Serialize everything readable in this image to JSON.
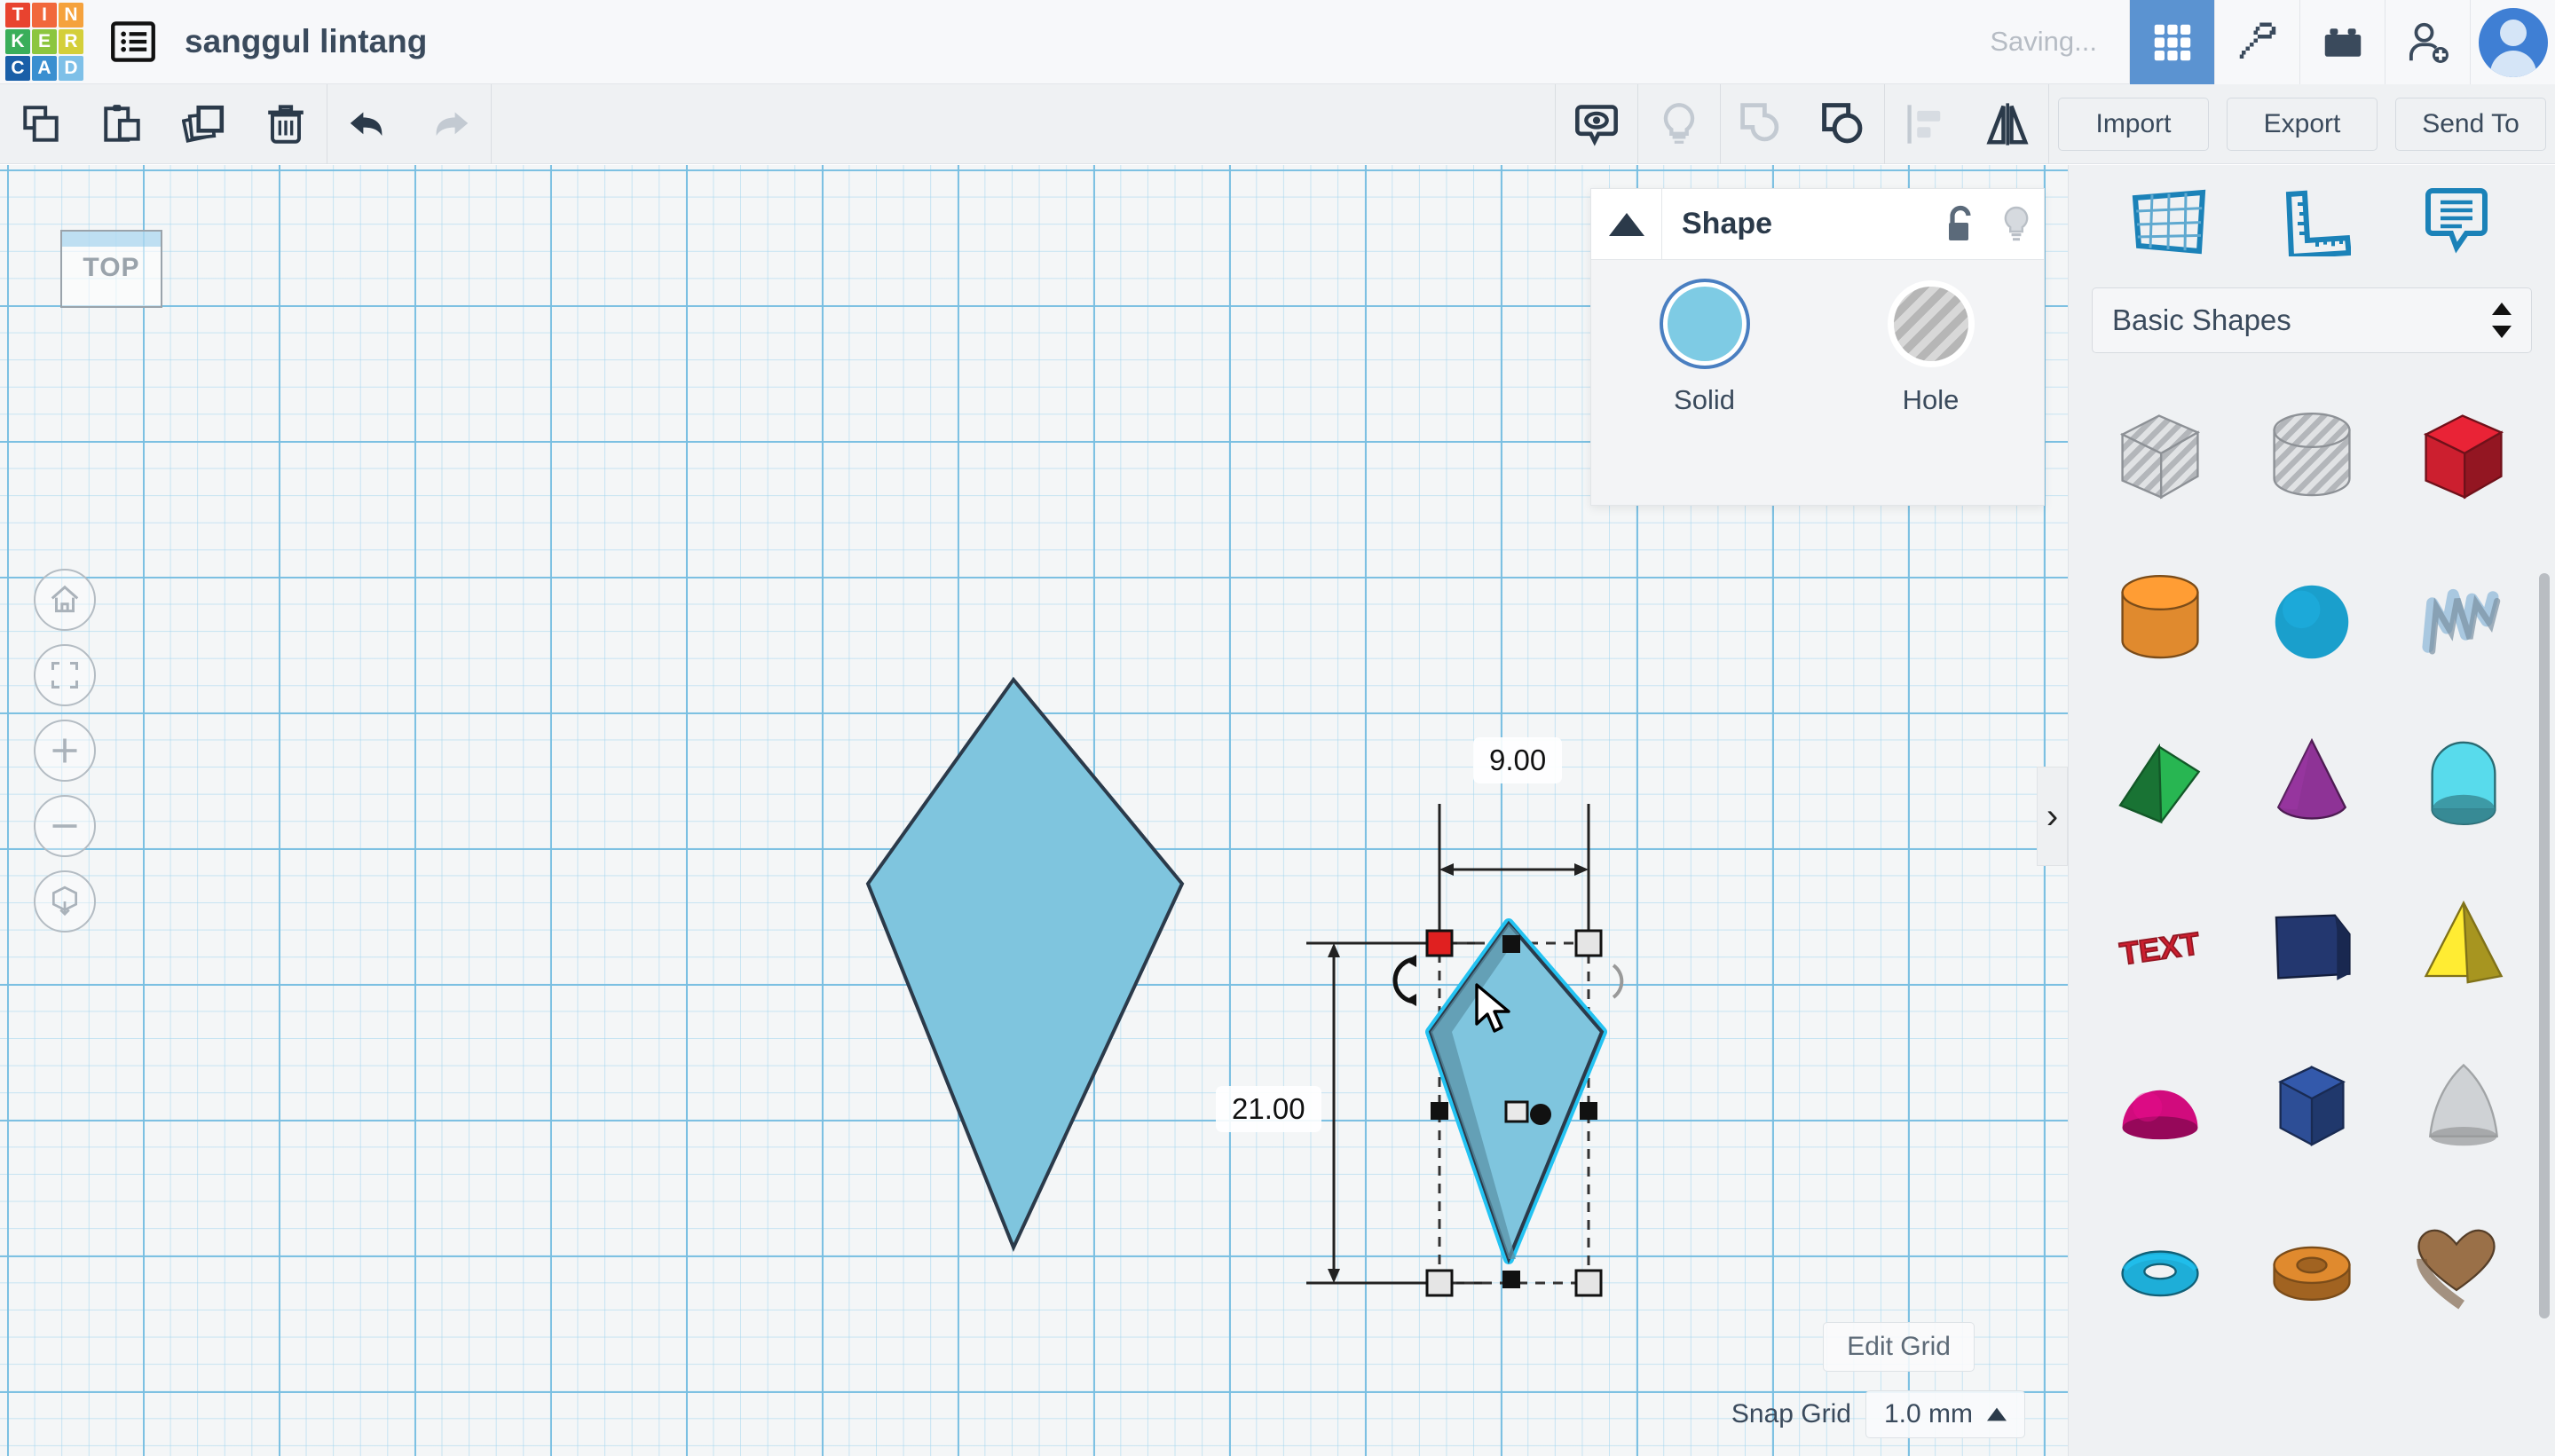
{
  "header": {
    "logo_letters": [
      "T",
      "I",
      "N",
      "K",
      "E",
      "R",
      "C",
      "A",
      "D"
    ],
    "logo_colors": [
      "#e8432f",
      "#f1683c",
      "#f5a23d",
      "#3aae5a",
      "#8cc63f",
      "#d4cf3a",
      "#1a5fa8",
      "#3a8fd0",
      "#7ec0e8"
    ],
    "design_list_icon": "list-icon",
    "title": "sanggul lintang",
    "status": "Saving...",
    "icons": [
      {
        "name": "gallery-grid-icon",
        "active": true
      },
      {
        "name": "minecraft-pickaxe-icon",
        "active": false
      },
      {
        "name": "lego-brick-icon",
        "active": false
      },
      {
        "name": "invite-person-icon",
        "active": false
      }
    ],
    "avatar": "user-avatar"
  },
  "toolbar": {
    "left_icons": [
      {
        "name": "copy-icon",
        "enabled": true
      },
      {
        "name": "paste-icon",
        "enabled": true
      },
      {
        "name": "duplicate-icon",
        "enabled": true
      },
      {
        "name": "delete-trash-icon",
        "enabled": true
      },
      {
        "name": "undo-icon",
        "enabled": true
      },
      {
        "name": "redo-icon",
        "enabled": false
      }
    ],
    "center_icons": [
      {
        "name": "show-hide-eye-icon",
        "enabled": true
      },
      {
        "name": "lightbulb-icon",
        "enabled": false
      },
      {
        "name": "ungroup-icon",
        "enabled": false
      },
      {
        "name": "group-icon",
        "enabled": true
      },
      {
        "name": "align-icon",
        "enabled": false
      },
      {
        "name": "mirror-flip-icon",
        "enabled": true
      }
    ],
    "import_label": "Import",
    "export_label": "Export",
    "sendto_label": "Send To"
  },
  "canvas": {
    "view_cube_label": "TOP",
    "nav_buttons": [
      {
        "name": "home-view-icon"
      },
      {
        "name": "fit-to-view-icon"
      },
      {
        "name": "zoom-in-icon"
      },
      {
        "name": "zoom-out-icon"
      },
      {
        "name": "perspective-toggle-icon"
      }
    ],
    "dimension_width": "9.00",
    "dimension_height": "21.00",
    "edit_grid_label": "Edit Grid",
    "snap_grid_label": "Snap Grid",
    "snap_grid_value": "1.0 mm",
    "shape_fill_color": "#7fc5de",
    "shape_outline_color": "#2b3a4a",
    "selection_highlight_color": "#24c3f2",
    "objects": [
      {
        "name": "kite-shape-large",
        "selected": false
      },
      {
        "name": "kite-shape-small",
        "selected": true
      }
    ]
  },
  "shape_panel": {
    "collapse_icon": "triangle-up-icon",
    "title": "Shape",
    "lock_icon": "unlock-icon",
    "light_icon": "lightbulb-icon",
    "options": [
      {
        "label": "Solid",
        "selected": true
      },
      {
        "label": "Hole",
        "selected": false
      }
    ]
  },
  "sidebar": {
    "top_icons": [
      {
        "name": "workplane-icon"
      },
      {
        "name": "ruler-icon"
      },
      {
        "name": "notes-icon"
      }
    ],
    "category_label": "Basic Shapes",
    "category_caret": "stepper-updown-icon",
    "shapes": [
      {
        "name": "box-hole",
        "color": "#c9cccf",
        "kind": "box",
        "hole": true
      },
      {
        "name": "cylinder-hole",
        "color": "#c9cccf",
        "kind": "cylinder",
        "hole": true
      },
      {
        "name": "box-red",
        "color": "#cc1f2f",
        "kind": "box",
        "hole": false
      },
      {
        "name": "cylinder-orange",
        "color": "#e08a2e",
        "kind": "cylinder",
        "hole": false
      },
      {
        "name": "sphere-blue",
        "color": "#1a9fcc",
        "kind": "sphere",
        "hole": false
      },
      {
        "name": "scribble-lightblue",
        "color": "#a9c8e0",
        "kind": "scribble",
        "hole": false
      },
      {
        "name": "wedge-green",
        "color": "#23a048",
        "kind": "wedge",
        "hole": false
      },
      {
        "name": "cone-purple",
        "color": "#8e3396",
        "kind": "cone",
        "hole": false
      },
      {
        "name": "roof-teal",
        "color": "#4dc0cf",
        "kind": "roof",
        "hole": false
      },
      {
        "name": "text-red",
        "color": "#cc1f2f",
        "kind": "text",
        "hole": false
      },
      {
        "name": "polygon-navy",
        "color": "#23376f",
        "kind": "polyblock",
        "hole": false
      },
      {
        "name": "pyramid-yellow",
        "color": "#e8cf2d",
        "kind": "pyramid",
        "hole": false
      },
      {
        "name": "halfsphere-pink",
        "color": "#d10b7d",
        "kind": "halfsphere",
        "hole": false
      },
      {
        "name": "hexprism-blue",
        "color": "#2d4e96",
        "kind": "hexprism",
        "hole": false
      },
      {
        "name": "paraboloid-gray",
        "color": "#cfd2d5",
        "kind": "paraboloid",
        "hole": false
      },
      {
        "name": "torus-cyan",
        "color": "#1eaed8",
        "kind": "torus",
        "hole": false
      },
      {
        "name": "tube-orange",
        "color": "#e08a2e",
        "kind": "tube",
        "hole": false
      },
      {
        "name": "heart-brown",
        "color": "#9a7048",
        "kind": "heart",
        "hole": false
      }
    ],
    "collapse_tab": "chevron-right-icon"
  }
}
